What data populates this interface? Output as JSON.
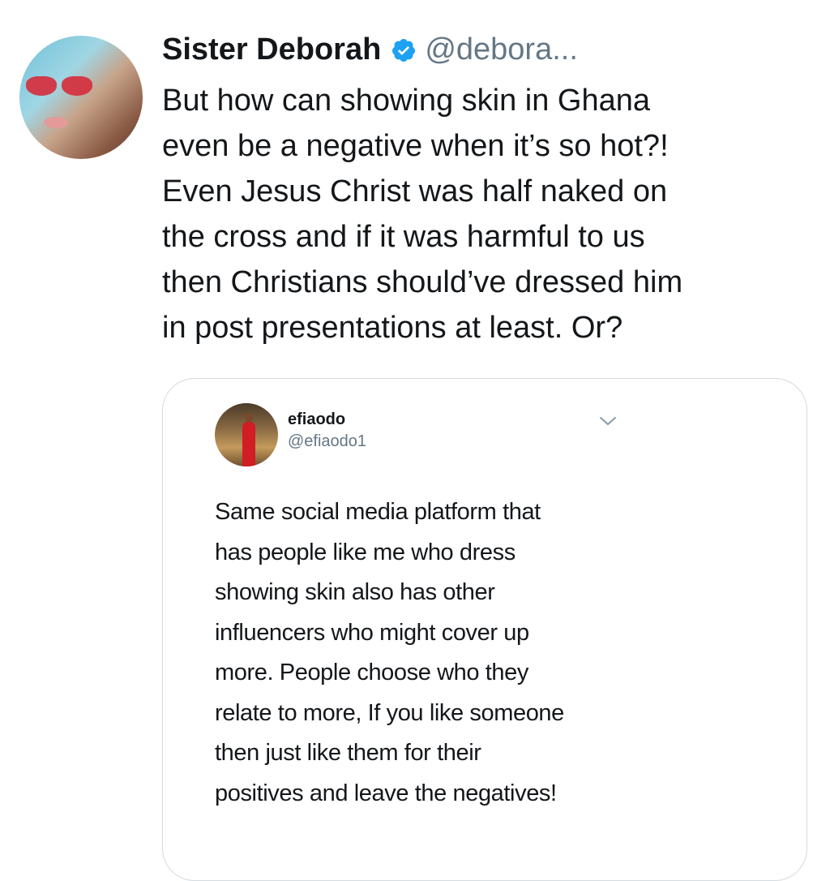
{
  "tweet": {
    "author_name": "Sister Deborah",
    "author_handle": "@debora...",
    "verified_icon": "verified-badge-icon",
    "lines": [
      "But how can showing skin in Ghana",
      "even be a negative when it’s so hot?!",
      "Even Jesus Christ was half naked on",
      "the cross and if it was harmful to us",
      "then Christians should’ve dressed him",
      "in post presentations at least. Or?"
    ]
  },
  "quoted_post": {
    "author_name": "efiaodo",
    "author_handle": "@efiaodo1",
    "menu_icon": "chevron-down-icon",
    "lines": [
      "Same social media platform that",
      "has people like me who dress",
      "showing skin also has other",
      "influencers who might cover up",
      "more. People choose who they",
      "relate to more, If you like someone",
      "then just like them for their",
      "positives and leave the negatives!"
    ]
  },
  "colors": {
    "text": "#14171a",
    "secondary": "#657786",
    "verified": "#1da1f2",
    "border": "#d4dadf"
  }
}
